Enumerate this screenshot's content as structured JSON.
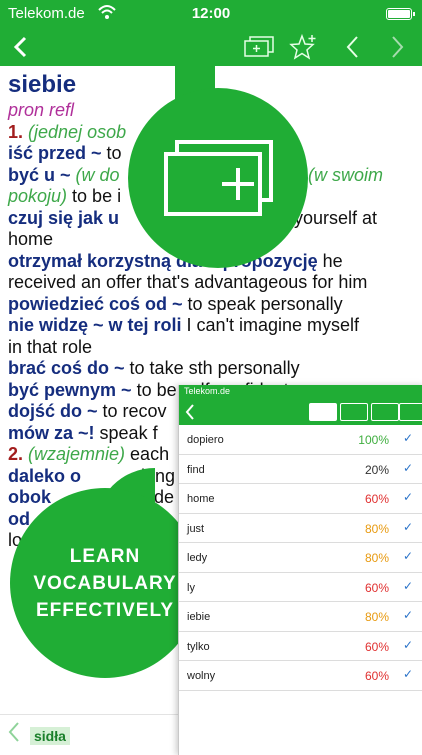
{
  "status": {
    "carrier": "Telekom.de",
    "time": "12:00"
  },
  "nav": {
    "back_icon": "chevron-left-icon",
    "add_card_icon": "add-flashcard-icon",
    "star_icon": "star-plus-icon",
    "prev_icon": "chevron-left-icon",
    "next_icon": "chevron-right-icon"
  },
  "entry": {
    "headword": "siebie",
    "pos": "pron refl",
    "sense1_num": "1.",
    "sense1_gloss": "(jednej osob",
    "lines": {
      "l1_phr": "iść przed ~",
      "l1_rest": " to",
      "l2_phr": "być u ~",
      "l2_gloss": " (w do",
      "l2_gloss_b": "(w swoim",
      "l3_gloss": "pokoju)",
      "l3_rest": " to be i",
      "l4_phr": "czuj się jak u",
      "l4_rest": "ke yourself at",
      "l5": "home",
      "l6_phr": "otrzymał korzystną dla ~ propozycję",
      "l6_rest": " he",
      "l7": "received an offer that's advantageous for him",
      "l8_phr": "powiedzieć coś od ~",
      "l8_rest": " to speak personally",
      "l9_phr": "nie widzę ~ w tej roli",
      "l9_rest": " I can't imagine myself",
      "l10": "in that role",
      "l11_phr": "brać coś do ~",
      "l11_rest": " to take sth personally",
      "l12_phr": "być pewnym ~",
      "l12_rest": " to be self-confident",
      "l13_phr": "dojść do ~",
      "l13_rest": " to recov",
      "l14_phr": "mów za ~!",
      "l14_rest": " speak f",
      "l15_num": "2.",
      "l15_gloss": " (wzajemnie)",
      "l15_rest": " each",
      "l16_phr": "daleko o",
      "l16_rest": "long",
      "l17_phr": "obok",
      "l17_rest": "side",
      "l18_phr": "od",
      "l19": "lo"
    }
  },
  "promo": {
    "line1": "LEARN",
    "line2": "VOCABULARY",
    "line3": "EFFECTIVELY"
  },
  "bottom": {
    "word": "sidła"
  },
  "phone": {
    "carrier": "Telekom.de",
    "words": [
      {
        "word": "dopiero",
        "percent": "100%",
        "color": "#3fae3f"
      },
      {
        "word": "find",
        "percent": "20%",
        "color": "#333333"
      },
      {
        "word": "home",
        "percent": "60%",
        "color": "#e03030"
      },
      {
        "word": "just",
        "percent": "80%",
        "color": "#e89a10"
      },
      {
        "word": "ledy",
        "percent": "80%",
        "color": "#e89a10"
      },
      {
        "word": "ly",
        "percent": "60%",
        "color": "#e03030"
      },
      {
        "word": "iebie",
        "percent": "80%",
        "color": "#e89a10"
      },
      {
        "word": "tylko",
        "percent": "60%",
        "color": "#e03030"
      },
      {
        "word": "wolny",
        "percent": "60%",
        "color": "#e03030"
      }
    ],
    "check": "✓"
  },
  "colors": {
    "brand_green": "#20ad35",
    "headword_blue": "#152d7e"
  }
}
